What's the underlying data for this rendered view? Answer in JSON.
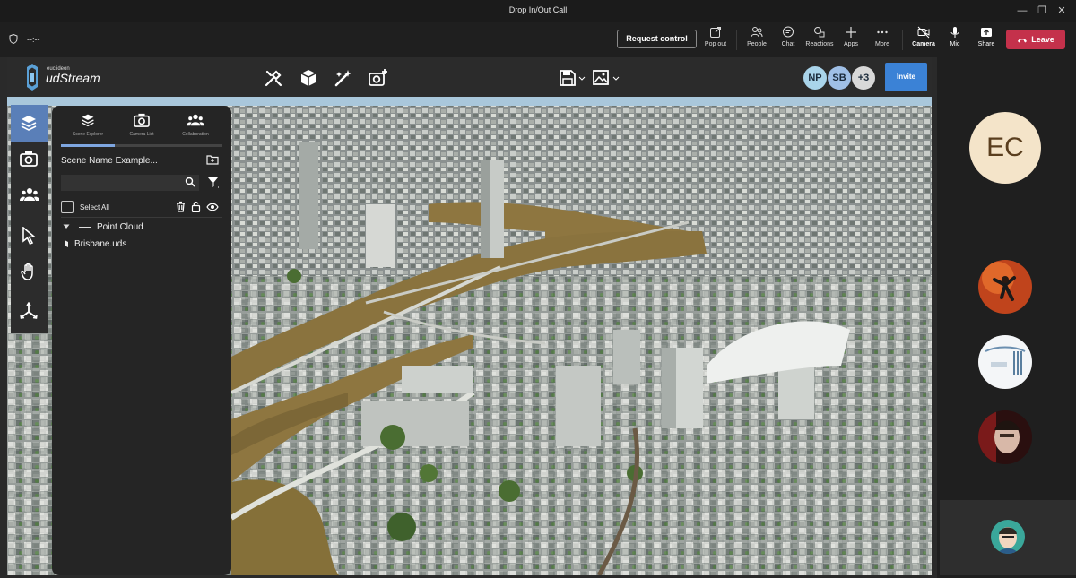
{
  "window": {
    "title": "Drop In/Out Call"
  },
  "meeting": {
    "timer": "--:--",
    "request_control": "Request control",
    "buttons": [
      {
        "key": "popout",
        "label": "Pop out"
      },
      {
        "key": "people",
        "label": "People"
      },
      {
        "key": "chat",
        "label": "Chat"
      },
      {
        "key": "reactions",
        "label": "Reactions"
      },
      {
        "key": "apps",
        "label": "Apps"
      },
      {
        "key": "more",
        "label": "More"
      },
      {
        "key": "camera",
        "label": "Camera"
      },
      {
        "key": "mic",
        "label": "Mic"
      },
      {
        "key": "share",
        "label": "Share"
      }
    ],
    "leave": "Leave",
    "leave_color": "#c4314b"
  },
  "udstream": {
    "logo_small": "euclideon",
    "logo_big": "udStream",
    "header_icons": [
      "tools-icon",
      "cube-icon",
      "magic-wand-icon",
      "add-camera-icon",
      "save-icon",
      "image-settings-icon"
    ],
    "collaborators": [
      {
        "initials": "NP",
        "color": "#a9d4ea"
      },
      {
        "initials": "SB",
        "color": "#9fbfe6"
      },
      {
        "initials": "+3",
        "color": "#d8d8d8"
      }
    ],
    "invite": "Invite",
    "accent": "#3b82d6",
    "tools": [
      "layers-icon",
      "camera-icon",
      "users-icon",
      "pointer-icon",
      "hand-icon",
      "axes-icon"
    ],
    "panel": {
      "tabs": [
        {
          "label": "Scene Explorer"
        },
        {
          "label": "Camera List"
        },
        {
          "label": "Collaboration"
        }
      ],
      "scene_name": "Scene Name Example...",
      "search_placeholder": "",
      "select_all": "Select All",
      "group": "Point Cloud",
      "file": "Brisbane.uds"
    }
  },
  "participants": {
    "main_initials": "EC",
    "main_color": "#f4e4c9"
  }
}
